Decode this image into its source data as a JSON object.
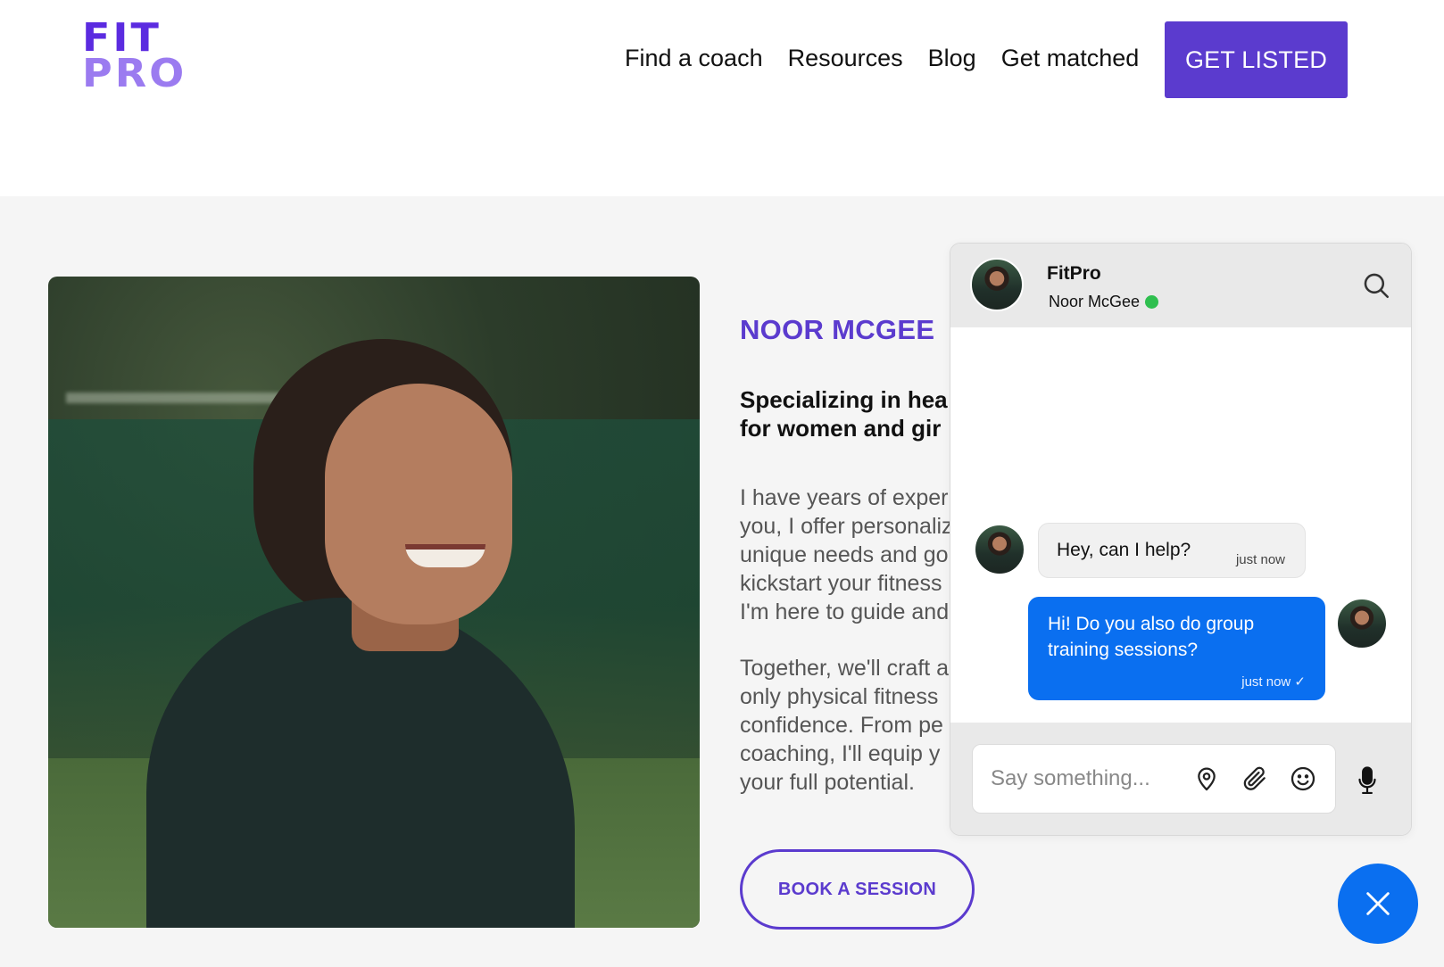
{
  "logo": {
    "line1": "FIT",
    "line2": "PRO"
  },
  "nav": {
    "items": [
      "Find a coach",
      "Resources",
      "Blog",
      "Get matched"
    ],
    "cta_label": "GET LISTED"
  },
  "profile": {
    "name": "NOOR MCGEE",
    "tagline_lines": [
      "Specializing in hea",
      "for women and gir"
    ],
    "bio_para1": [
      "I have years of exper",
      "you, I offer personaliz",
      "unique needs and go",
      "kickstart your fitness",
      "I'm here to guide and"
    ],
    "bio_para2": [
      "Together, we'll craft a",
      "only physical fitness",
      "confidence. From pe",
      "coaching, I'll equip y",
      "your full potential."
    ],
    "book_label": "BOOK A SESSION"
  },
  "chat": {
    "title": "FitPro",
    "agent_name": "Noor McGee",
    "status_color": "#2fbf4f",
    "messages": [
      {
        "direction": "incoming",
        "text": "Hey, can I help?",
        "time": "just now"
      },
      {
        "direction": "outgoing",
        "text": "Hi! Do you also do group training sessions?",
        "time": "just now ✓"
      }
    ],
    "input_placeholder": "Say something...",
    "icons": [
      "search-icon",
      "location-pin-icon",
      "paperclip-icon",
      "emoji-icon",
      "microphone-icon",
      "close-icon"
    ]
  },
  "colors": {
    "brand": "#5b3bce",
    "chat_accent": "#0a6ff0"
  }
}
